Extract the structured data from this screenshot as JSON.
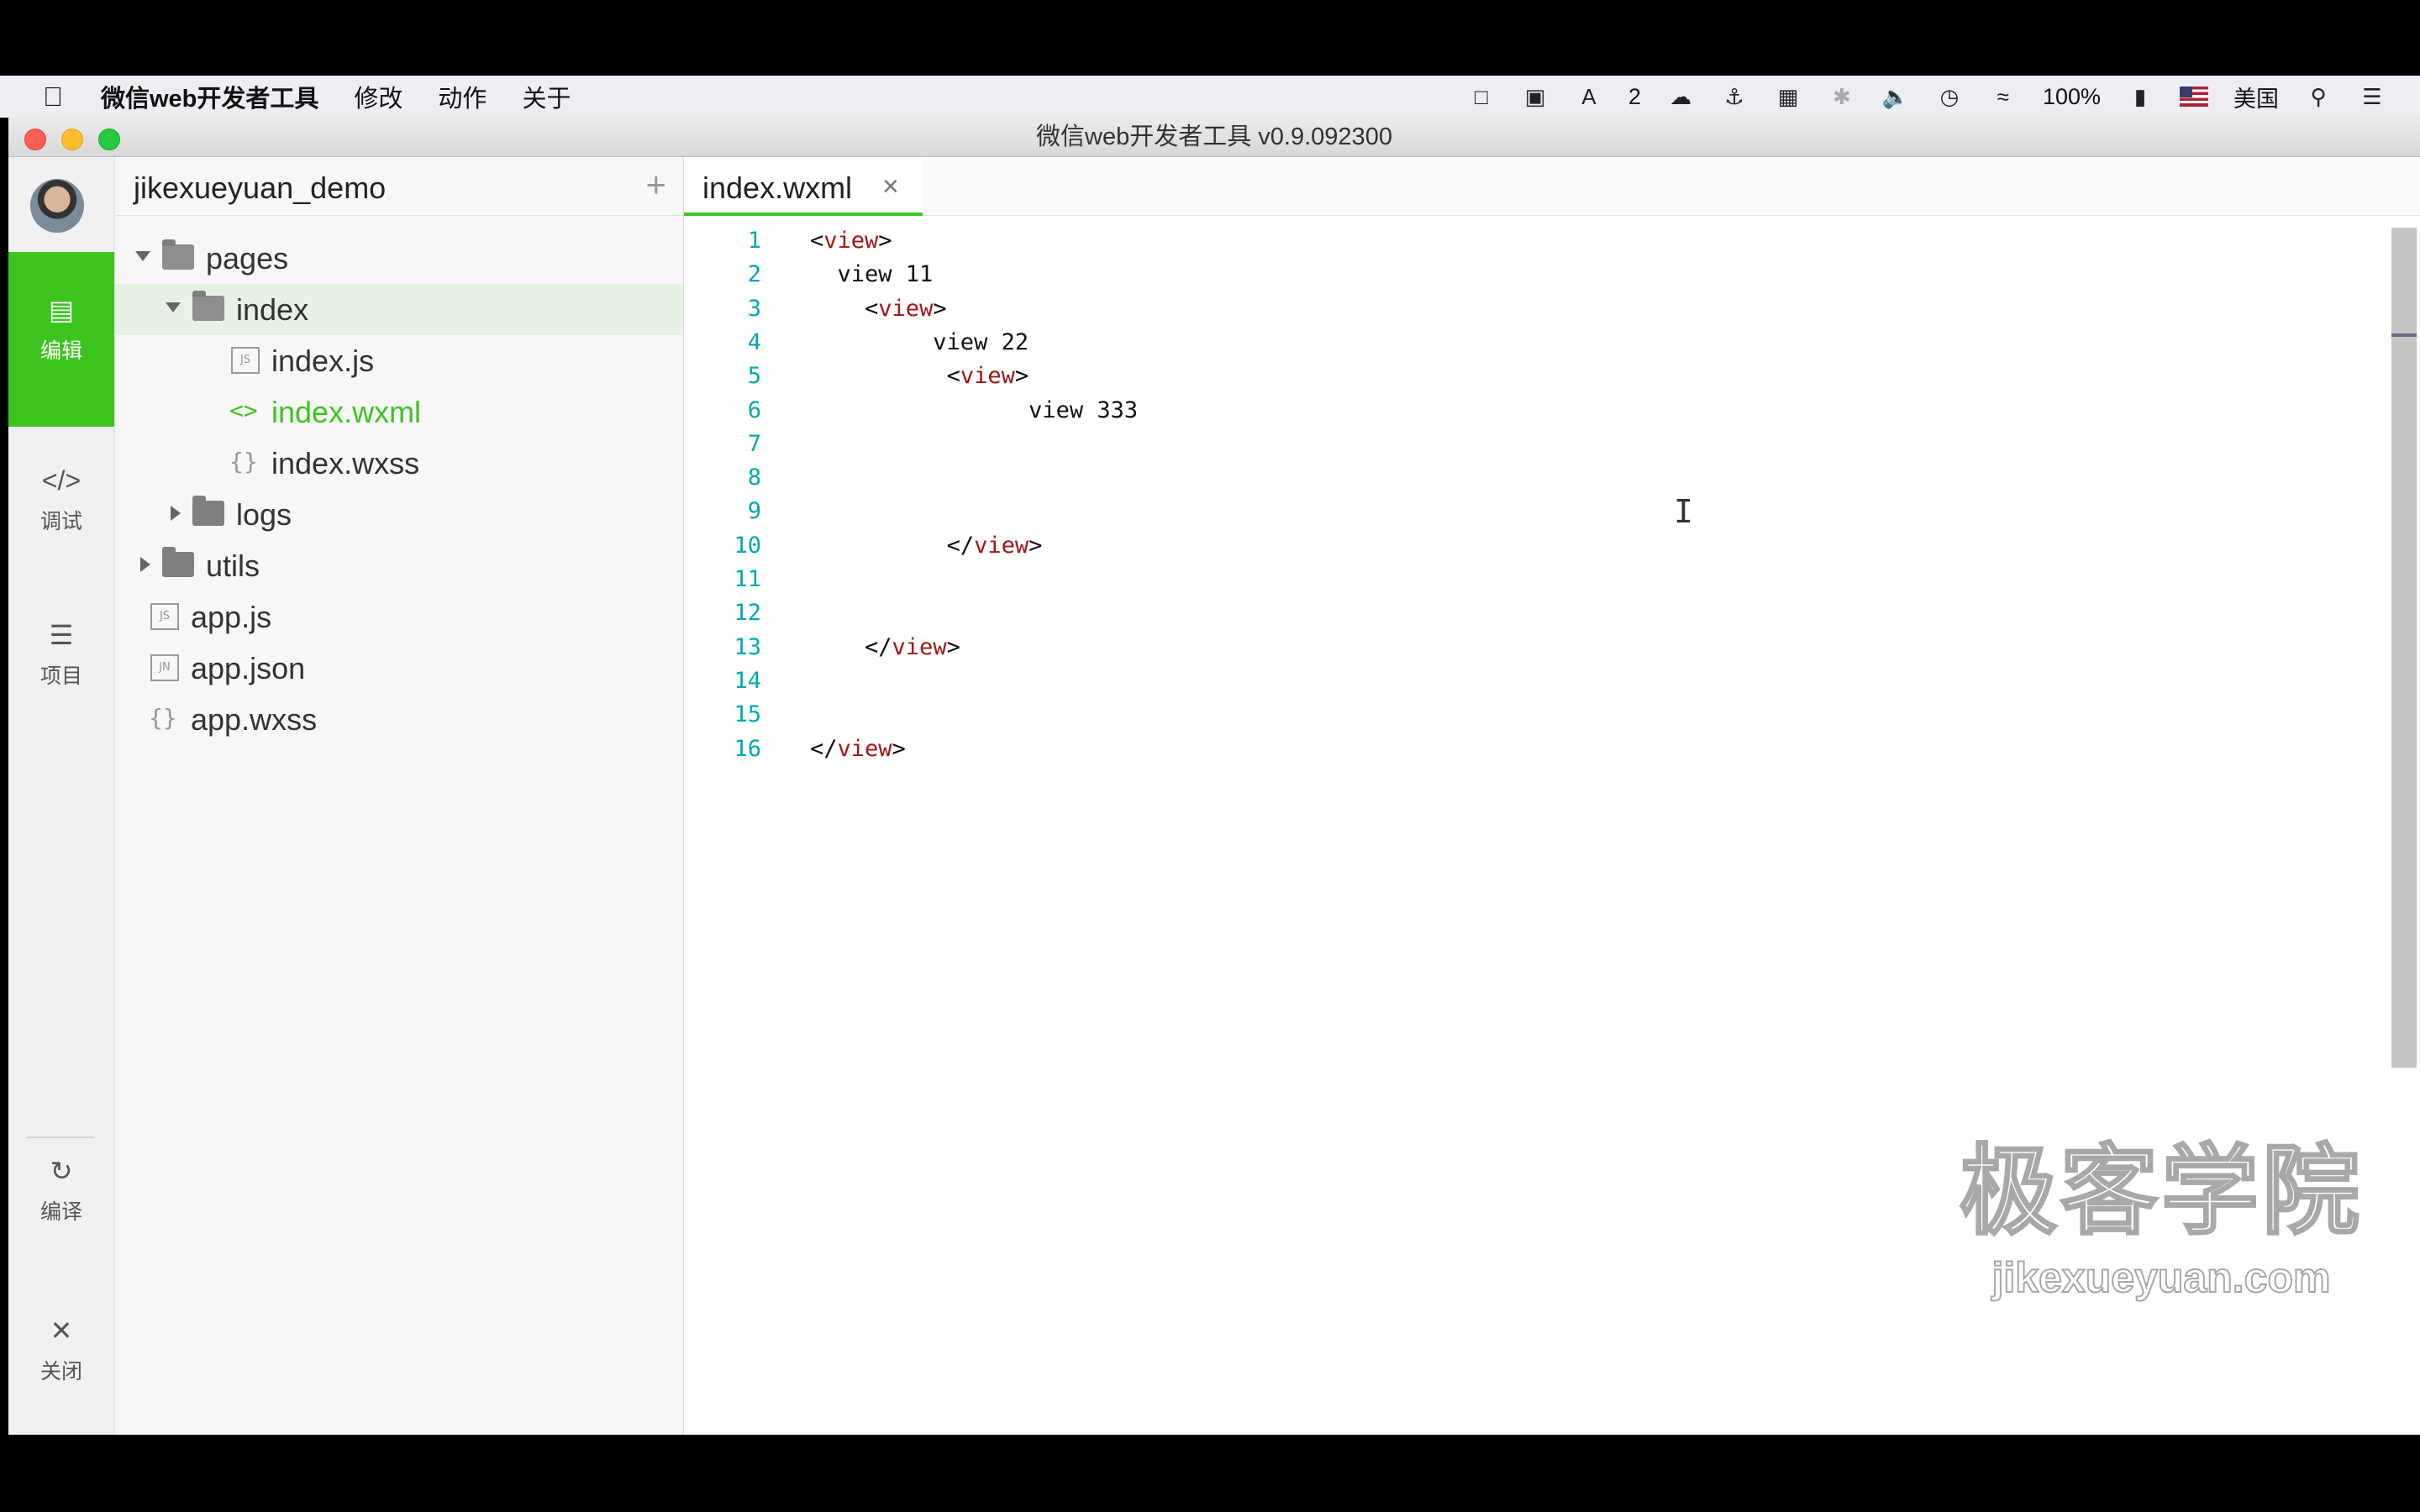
{
  "menubar": {
    "app_name": "微信web开发者工具",
    "items": [
      "修改",
      "动作",
      "关于"
    ],
    "status": {
      "badge_count": "2",
      "battery": "100%",
      "input_source": "美国"
    }
  },
  "window": {
    "title": "微信web开发者工具 v0.9.092300"
  },
  "rail": {
    "items": [
      {
        "label": "编辑",
        "icon": "code-screen-icon"
      },
      {
        "label": "调试",
        "icon": "code-brackets-icon"
      },
      {
        "label": "项目",
        "icon": "menu-lines-icon"
      },
      {
        "label": "编译",
        "icon": "compile-icon"
      },
      {
        "label": "关闭",
        "icon": "close-icon"
      }
    ]
  },
  "sidebar": {
    "project_name": "jikexueyuan_demo",
    "add_symbol": "+",
    "tree": [
      {
        "label": "pages",
        "type": "folder",
        "expanded": true
      },
      {
        "label": "index",
        "type": "folder",
        "expanded": true,
        "selected": true
      },
      {
        "label": "index.js",
        "type": "js",
        "badge": "JS"
      },
      {
        "label": "index.wxml",
        "type": "wxml",
        "active": true
      },
      {
        "label": "index.wxss",
        "type": "wxss"
      },
      {
        "label": "logs",
        "type": "folder",
        "expanded": false
      },
      {
        "label": "utils",
        "type": "folder",
        "expanded": false
      },
      {
        "label": "app.js",
        "type": "js",
        "badge": "JS"
      },
      {
        "label": "app.json",
        "type": "json",
        "badge": "JN"
      },
      {
        "label": "app.wxss",
        "type": "wxss"
      }
    ]
  },
  "editor": {
    "tab_label": "index.wxml",
    "tab_close": "×",
    "lines": [
      {
        "n": "1",
        "code": "<view>"
      },
      {
        "n": "2",
        "code": "  view 11"
      },
      {
        "n": "3",
        "code": "    <view>"
      },
      {
        "n": "4",
        "code": "         view 22"
      },
      {
        "n": "5",
        "code": "          <view>"
      },
      {
        "n": "6",
        "code": "                view 333"
      },
      {
        "n": "7",
        "code": ""
      },
      {
        "n": "8",
        "code": ""
      },
      {
        "n": "9",
        "code": ""
      },
      {
        "n": "10",
        "code": "          </view>"
      },
      {
        "n": "11",
        "code": ""
      },
      {
        "n": "12",
        "code": ""
      },
      {
        "n": "13",
        "code": "    </view>"
      },
      {
        "n": "14",
        "code": ""
      },
      {
        "n": "15",
        "code": ""
      },
      {
        "n": "16",
        "code": "</view>"
      }
    ]
  },
  "watermark": {
    "cn": "极客学院",
    "en": "jikexueyuan.com"
  },
  "colors": {
    "accent": "#3cc51f",
    "line_numbers": "#00aaaa",
    "tag": "#a31515"
  }
}
